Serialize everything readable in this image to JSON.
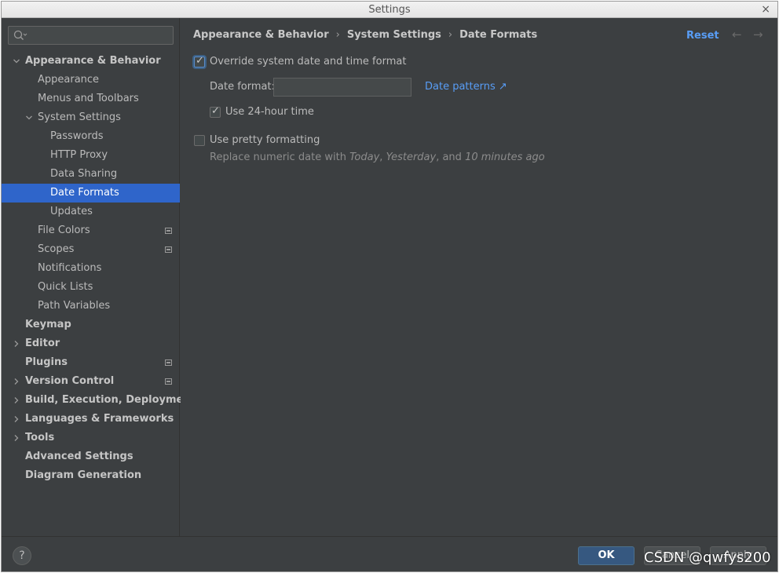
{
  "window": {
    "title": "Settings",
    "close_glyph": "×"
  },
  "search": {
    "placeholder": "",
    "icon": "search-icon"
  },
  "tree": [
    {
      "label": "Appearance & Behavior",
      "depth": 0,
      "bold": true,
      "arrow": "down",
      "badge": false
    },
    {
      "label": "Appearance",
      "depth": 1,
      "bold": false,
      "arrow": "",
      "badge": false
    },
    {
      "label": "Menus and Toolbars",
      "depth": 1,
      "bold": false,
      "arrow": "",
      "badge": false
    },
    {
      "label": "System Settings",
      "depth": 1,
      "bold": false,
      "arrow": "down",
      "badge": false
    },
    {
      "label": "Passwords",
      "depth": 2,
      "bold": false,
      "arrow": "",
      "badge": false
    },
    {
      "label": "HTTP Proxy",
      "depth": 2,
      "bold": false,
      "arrow": "",
      "badge": false
    },
    {
      "label": "Data Sharing",
      "depth": 2,
      "bold": false,
      "arrow": "",
      "badge": false
    },
    {
      "label": "Date Formats",
      "depth": 2,
      "bold": false,
      "arrow": "",
      "badge": false,
      "selected": true
    },
    {
      "label": "Updates",
      "depth": 2,
      "bold": false,
      "arrow": "",
      "badge": false
    },
    {
      "label": "File Colors",
      "depth": 1,
      "bold": false,
      "arrow": "",
      "badge": true
    },
    {
      "label": "Scopes",
      "depth": 1,
      "bold": false,
      "arrow": "",
      "badge": true
    },
    {
      "label": "Notifications",
      "depth": 1,
      "bold": false,
      "arrow": "",
      "badge": false
    },
    {
      "label": "Quick Lists",
      "depth": 1,
      "bold": false,
      "arrow": "",
      "badge": false
    },
    {
      "label": "Path Variables",
      "depth": 1,
      "bold": false,
      "arrow": "",
      "badge": false
    },
    {
      "label": "Keymap",
      "depth": 0,
      "bold": true,
      "arrow": "",
      "badge": false
    },
    {
      "label": "Editor",
      "depth": 0,
      "bold": true,
      "arrow": "right",
      "badge": false
    },
    {
      "label": "Plugins",
      "depth": 0,
      "bold": true,
      "arrow": "",
      "badge": true
    },
    {
      "label": "Version Control",
      "depth": 0,
      "bold": true,
      "arrow": "right",
      "badge": true
    },
    {
      "label": "Build, Execution, Deployment",
      "depth": 0,
      "bold": true,
      "arrow": "right",
      "badge": false
    },
    {
      "label": "Languages & Frameworks",
      "depth": 0,
      "bold": true,
      "arrow": "right",
      "badge": false
    },
    {
      "label": "Tools",
      "depth": 0,
      "bold": true,
      "arrow": "right",
      "badge": false
    },
    {
      "label": "Advanced Settings",
      "depth": 0,
      "bold": true,
      "arrow": "",
      "badge": false
    },
    {
      "label": "Diagram Generation",
      "depth": 0,
      "bold": true,
      "arrow": "",
      "badge": false
    }
  ],
  "breadcrumb": [
    "Appearance & Behavior",
    "System Settings",
    "Date Formats"
  ],
  "breadcrumb_sep": "›",
  "header": {
    "reset_label": "Reset",
    "back_glyph": "←",
    "forward_glyph": "→"
  },
  "options": {
    "override": {
      "label": "Override system date and time format",
      "checked": true
    },
    "date_format_label": "Date format:",
    "date_format_value": "",
    "date_patterns_link": "Date patterns ↗",
    "use_24h": {
      "label": "Use 24-hour time",
      "checked": true
    },
    "pretty": {
      "label": "Use pretty formatting",
      "checked": false
    },
    "pretty_hint": {
      "prefix": "Replace numeric date with ",
      "today": "Today",
      "comma": ", ",
      "yesterday": "Yesterday",
      "and": ", and ",
      "minutes": "10 minutes ago"
    }
  },
  "footer": {
    "help_glyph": "?",
    "ok_label": "OK",
    "cancel_label": "Cancel",
    "apply_label": "Apply",
    "watermark": "CSDN @qwfys200"
  },
  "colors": {
    "selection": "#2f65ca",
    "link": "#589df6",
    "background": "#3c3f41",
    "primary_button": "#365880"
  }
}
